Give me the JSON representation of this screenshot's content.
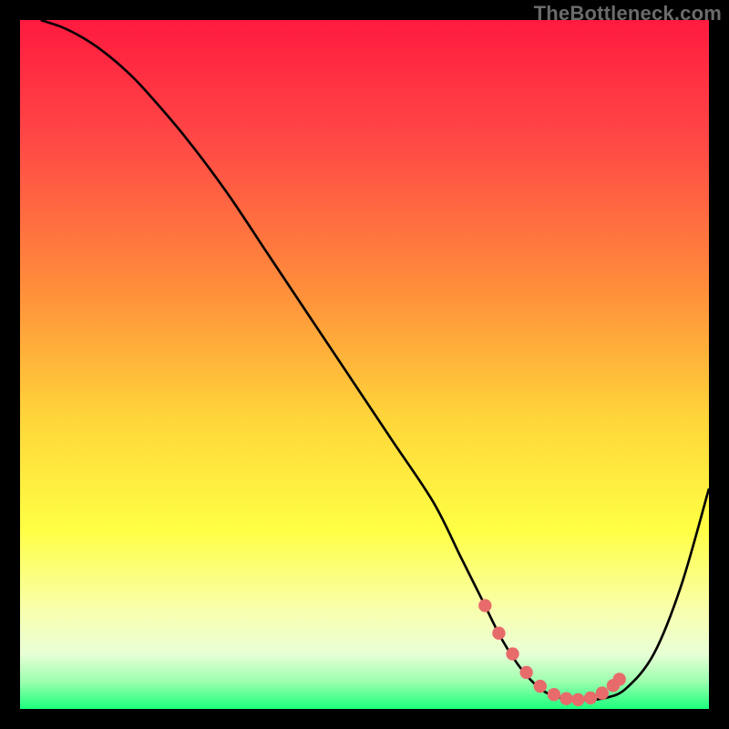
{
  "watermark": "TheBottleneck.com",
  "colors": {
    "frame": "#000000",
    "watermark": "#6b6b6b",
    "curve": "#000000",
    "dots": "#e86b6b",
    "gradient_stops": [
      {
        "pct": 0,
        "color": "#ff1a3f"
      },
      {
        "pct": 18,
        "color": "#ff4a46"
      },
      {
        "pct": 38,
        "color": "#ff8a3b"
      },
      {
        "pct": 58,
        "color": "#ffd63a"
      },
      {
        "pct": 74,
        "color": "#ffff44"
      },
      {
        "pct": 86,
        "color": "#f8ffb0"
      },
      {
        "pct": 92,
        "color": "#e8ffd6"
      },
      {
        "pct": 96,
        "color": "#9dffaf"
      },
      {
        "pct": 100,
        "color": "#1aff7c"
      }
    ]
  },
  "chart_data": {
    "type": "line",
    "title": "",
    "xlabel": "",
    "ylabel": "",
    "xlim": [
      0,
      100
    ],
    "ylim": [
      0,
      100
    ],
    "series": [
      {
        "name": "bottleneck-curve",
        "x": [
          3,
          6,
          9,
          12,
          15,
          18,
          24,
          30,
          36,
          42,
          48,
          54,
          60,
          64,
          67,
          70,
          73,
          76,
          79,
          82,
          85,
          88,
          92,
          96,
          100
        ],
        "y": [
          100,
          99,
          97.5,
          95.5,
          93,
          90,
          83,
          75,
          66,
          57,
          48,
          39,
          30,
          22,
          16,
          10,
          5.5,
          2.6,
          1.5,
          1.3,
          1.6,
          3,
          8,
          18,
          32
        ]
      }
    ],
    "markers": {
      "name": "optimal-range-dots",
      "x": [
        67.5,
        69.5,
        71.5,
        73.5,
        75.5,
        77.5,
        79.3,
        81,
        82.8,
        84.5,
        86.1,
        87
      ],
      "y": [
        15,
        11,
        8,
        5.3,
        3.3,
        2.1,
        1.5,
        1.35,
        1.6,
        2.3,
        3.4,
        4.3
      ]
    }
  }
}
